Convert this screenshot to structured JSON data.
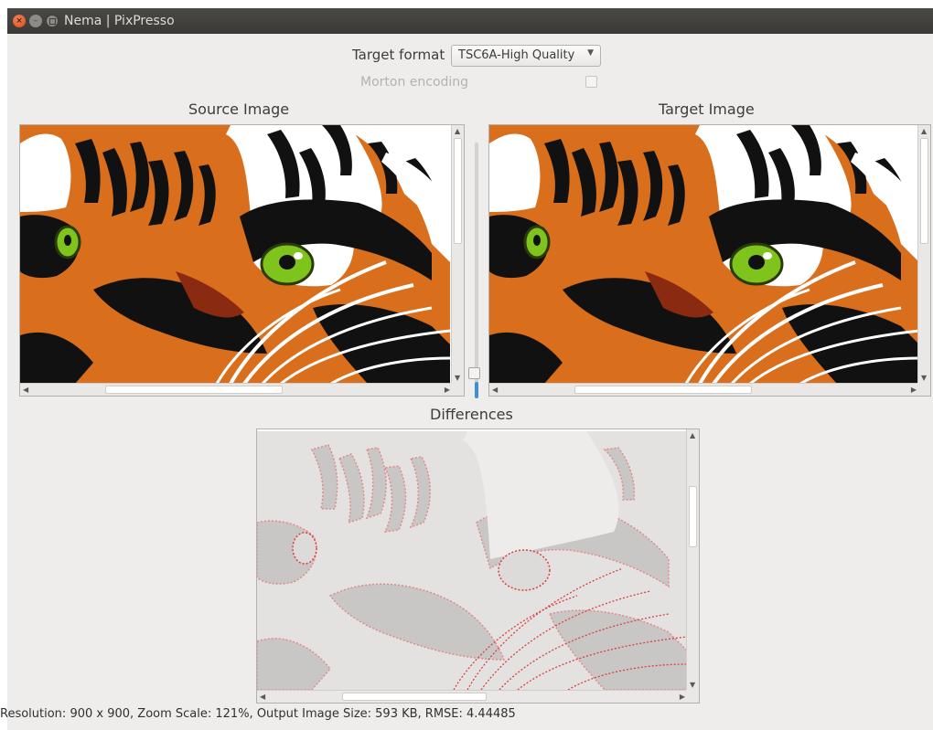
{
  "window": {
    "title": "Nema | PixPresso"
  },
  "controls": {
    "target_format_label": "Target format",
    "target_format_value": "TSC6A-High Quality",
    "morton_label": "Morton encoding",
    "morton_checked": false
  },
  "panels": {
    "source_title": "Source Image",
    "target_title": "Target Image",
    "differences_title": "Differences"
  },
  "colors": {
    "accent": "#3d8fd8",
    "tiger_orange": "#d96f1c",
    "eye_green": "#7fc41c",
    "diff_red": "#d94040"
  },
  "icons": {
    "close": "close-icon",
    "minimize": "minimize-icon",
    "maximize": "maximize-icon",
    "dropdown": "chevron-down-icon"
  },
  "status": {
    "text": "Resolution: 900 x 900, Zoom Scale: 121%, Output Image Size: 593 KB, RMSE: 4.44485"
  }
}
